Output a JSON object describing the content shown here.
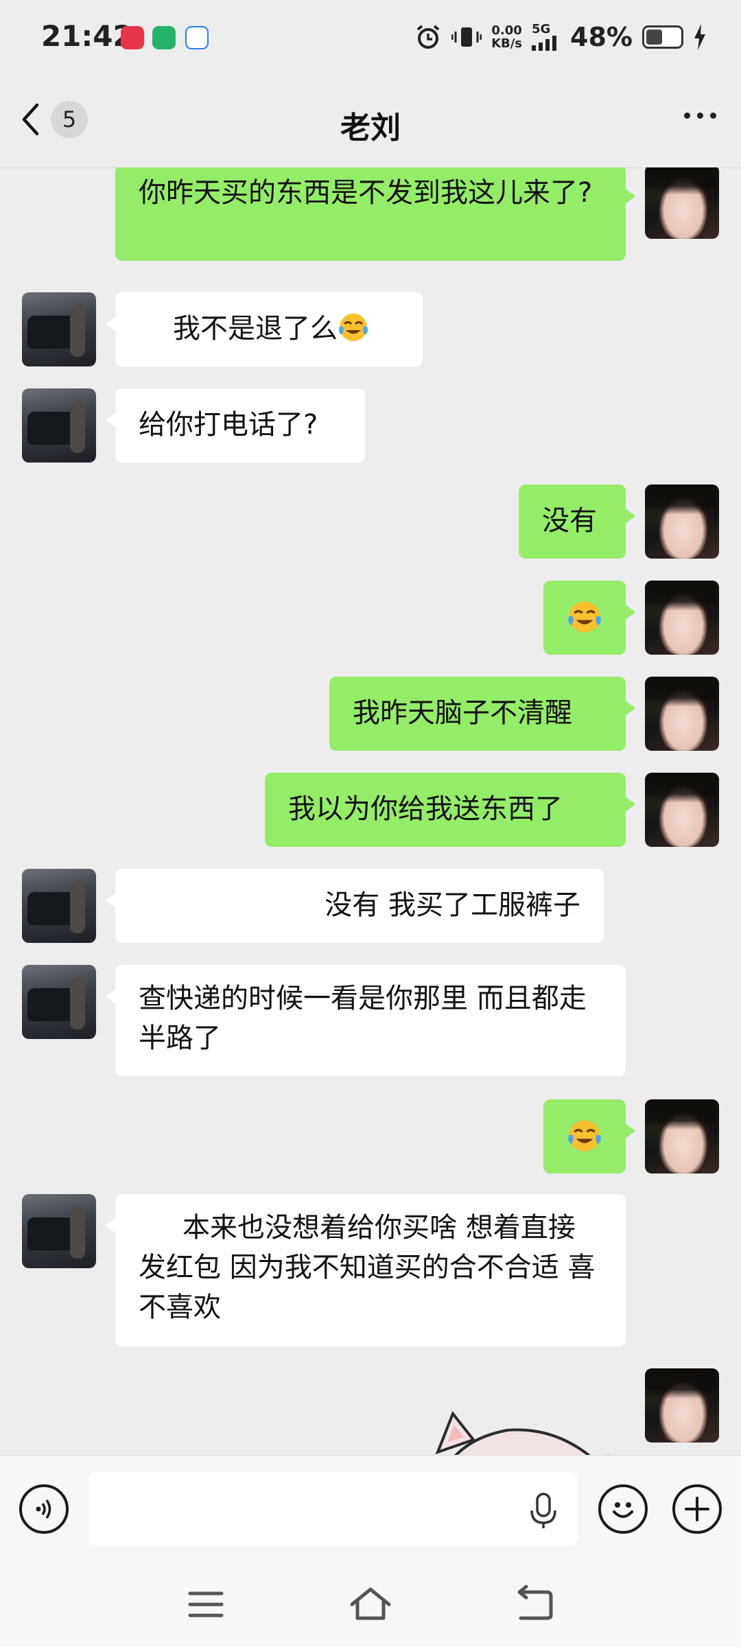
{
  "status_bar": {
    "time": "21:42",
    "net_speed_value": "0.00",
    "net_speed_unit": "KB/s",
    "network_type": "5G",
    "battery_percent": "48%",
    "battery_level": 0.48
  },
  "header": {
    "unread_count": "5",
    "title": "老刘"
  },
  "messages": [
    {
      "side": "mine",
      "text": "你昨天买的东西是不发到我这儿来了?"
    },
    {
      "side": "other",
      "text": "我不是退了么",
      "emoji": "crying-laughing"
    },
    {
      "side": "other",
      "text": "给你打电话了?"
    },
    {
      "side": "mine",
      "text": "没有"
    },
    {
      "side": "mine",
      "text": "",
      "emoji": "crying-laughing"
    },
    {
      "side": "mine",
      "text": "我昨天脑子不清醒"
    },
    {
      "side": "mine",
      "text": "我以为你给我送东西了"
    },
    {
      "side": "other",
      "text": "没有 我买了工服裤子"
    },
    {
      "side": "other",
      "text": "查快递的时候一看是你那里 而且都走半路了"
    },
    {
      "side": "mine",
      "text": "",
      "emoji": "crying-laughing"
    },
    {
      "side": "other",
      "text": "本来也没想着给你买啥 想着直接发红包 因为我不知道买的合不合适 喜不喜欢"
    },
    {
      "side": "mine",
      "sticker": "pig-sticker"
    }
  ],
  "input_bar": {
    "value": "",
    "placeholder": ""
  },
  "colors": {
    "my_bubble": "#95ec69",
    "other_bubble": "#ffffff",
    "background": "#ededed"
  }
}
